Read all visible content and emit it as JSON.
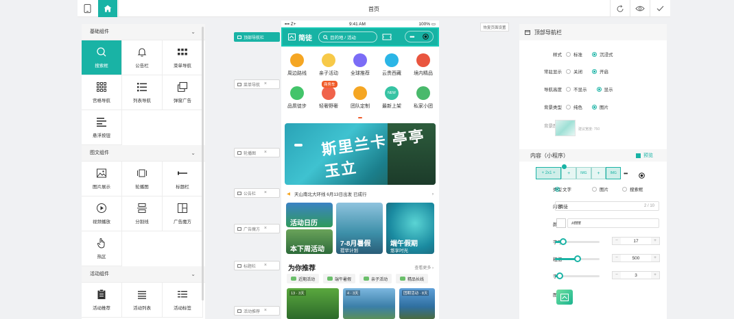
{
  "topbar": {
    "title": "首页"
  },
  "left": {
    "sections": [
      {
        "title": "基础组件",
        "items": [
          {
            "label": "搜索框",
            "icon": "search-icon",
            "active": true
          },
          {
            "label": "公告栏",
            "icon": "bell-icon"
          },
          {
            "label": "菜单导航",
            "icon": "menu-grid-icon"
          },
          {
            "label": "宫格导航",
            "icon": "grid-nine-icon"
          },
          {
            "label": "列表导航",
            "icon": "list-icon"
          },
          {
            "label": "弹窗广告",
            "icon": "popup-icon"
          },
          {
            "label": "悬浮按钮",
            "icon": "float-icon"
          }
        ]
      },
      {
        "title": "图文组件",
        "items": [
          {
            "label": "图片展示",
            "icon": "image-icon"
          },
          {
            "label": "轮播图",
            "icon": "carousel-icon"
          },
          {
            "label": "标题栏",
            "icon": "title-icon"
          },
          {
            "label": "视频播放",
            "icon": "play-icon"
          },
          {
            "label": "分割线",
            "icon": "divider-icon"
          },
          {
            "label": "广告魔方",
            "icon": "cube-icon"
          },
          {
            "label": "热区",
            "icon": "hand-icon"
          }
        ]
      },
      {
        "title": "活动组件",
        "items": [
          {
            "label": "活动推荐",
            "icon": "clipboard-icon"
          },
          {
            "label": "活动列表",
            "icon": "list-lines-icon"
          },
          {
            "label": "活动标签",
            "icon": "tag-list-icon"
          }
        ]
      }
    ]
  },
  "tags": [
    {
      "label": "顶部导航栏",
      "active": true
    },
    {
      "label": "菜单导航"
    },
    {
      "label": "轮播图"
    },
    {
      "label": "公告栏"
    },
    {
      "label": "广告魔方"
    },
    {
      "label": "标题栏"
    },
    {
      "label": "活动推荐"
    }
  ],
  "phone": {
    "status": {
      "carrier": "Z+",
      "time": "9:41 AM",
      "battery": "100%"
    },
    "nav": {
      "logo": "简徒",
      "search": "目的地 / 活动"
    },
    "icons_row1": [
      {
        "label": "周边路线",
        "color": "#f5a623"
      },
      {
        "label": "亲子活动",
        "color": "#f7c948"
      },
      {
        "label": "全球推荐",
        "color": "#7b6cf6"
      },
      {
        "label": "云贵西藏",
        "color": "#2bb5e6"
      },
      {
        "label": "境内精品",
        "color": "#e9553f"
      }
    ],
    "icons_row2": [
      {
        "label": "品质徒步",
        "color": "#43c46a"
      },
      {
        "label": "轻奢野奢",
        "color": "#f0634b"
      },
      {
        "label": "团队定制",
        "color": "#f5a623"
      },
      {
        "label": "最新上架",
        "color": "#36c3a3"
      },
      {
        "label": "私家小团",
        "color": "#49b96b"
      }
    ],
    "badge": "商务车",
    "new_badge": "NEW",
    "banner_text": "斯里兰卡 亭亭玉立",
    "notice": "天山南北大环线 6月13日出发 已成行",
    "mag": [
      {
        "title": "活动日历"
      },
      {
        "title": "7-8月暑假",
        "sub": "提早计划"
      },
      {
        "title": "端午假期",
        "sub": "悠享时光"
      },
      {
        "title": "本下周活动"
      }
    ],
    "rec_title": "为你推荐",
    "rec_more": "查看更多 ›",
    "rec_tabs": [
      "近期活动",
      "端午暑假",
      "亲子活动",
      "精品长线"
    ],
    "thumbs": [
      "13 · 3天",
      "4 · 3天",
      "团期活动 · 8天"
    ]
  },
  "reset_btn": "恢复页面设置",
  "right": {
    "title": "顶部导航栏",
    "rows": [
      {
        "label": "样式",
        "opts": [
          "标准",
          "沉浸式"
        ],
        "on": 1
      },
      {
        "label": "常驻显示",
        "opts": [
          "关闭",
          "开启"
        ],
        "on": 1
      },
      {
        "label": "导航高度",
        "opts": [
          "不显示",
          "显示"
        ],
        "on": 1
      },
      {
        "label": "背景类型",
        "opts": [
          "纯色",
          "图片"
        ],
        "on": 1
      }
    ],
    "bg_label": "背景图片",
    "bg_hint": "建议宽度: 750",
    "content_title": "内容（小程序）",
    "preview": "预览",
    "seg_labels": [
      "+ 2x1 +",
      "+",
      "IMG",
      "+",
      "IMG"
    ],
    "type_label": "类型",
    "type_opts": [
      "文字",
      "图片",
      "搜索框"
    ],
    "content_label": "内容",
    "content_value": "简徒",
    "content_count": "2 / 10",
    "color_label": "颜色",
    "color_value": "#ffffff",
    "size_label": "字号",
    "size_value": "17",
    "weight_label": "粗细",
    "weight_value": "500",
    "spacing_label": "字距",
    "spacing_value": "3",
    "icon_label": "图标",
    "sliders": {
      "size": 0.18,
      "weight": 0.5,
      "spacing": 0.1
    }
  }
}
